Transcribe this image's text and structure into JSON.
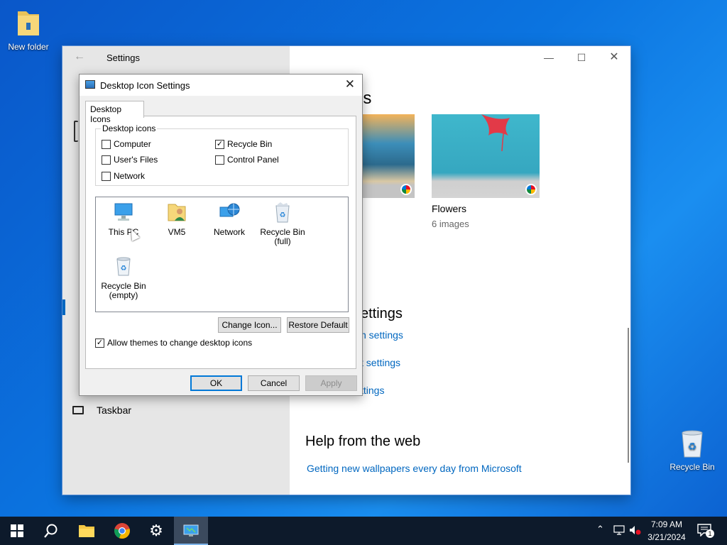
{
  "desktop": {
    "icons": [
      {
        "label": "New folder",
        "icon": "folder-icon"
      },
      {
        "label": "Recycle Bin",
        "icon": "recycle-bin-icon"
      }
    ]
  },
  "settings": {
    "title": "Settings",
    "left_items": [
      {
        "label": "Taskbar",
        "icon": "taskbar-icon"
      }
    ],
    "theme_section_heading_fragment": "es",
    "themes": [
      {
        "name": "",
        "count": ""
      },
      {
        "name": "Flowers",
        "count": "6 images"
      }
    ],
    "related_heading_fragment": "ettings",
    "related_links": [
      "n settings",
      "t settings",
      "ttings"
    ],
    "help_heading": "Help from the web",
    "help_link": "Getting new wallpapers every day from Microsoft"
  },
  "dialog": {
    "title": "Desktop Icon Settings",
    "tab_label": "Desktop Icons",
    "group_label": "Desktop icons",
    "checkboxes": [
      {
        "label": "Computer",
        "checked": false
      },
      {
        "label": "Recycle Bin",
        "checked": true
      },
      {
        "label": "User's Files",
        "checked": false
      },
      {
        "label": "Control Panel",
        "checked": false
      },
      {
        "label": "Network",
        "checked": false
      }
    ],
    "icons": [
      {
        "label": "This PC",
        "icon": "monitor-icon"
      },
      {
        "label": "VM5",
        "icon": "user-folder-icon"
      },
      {
        "label": "Network",
        "icon": "network-globe-icon"
      },
      {
        "label": "Recycle Bin\n(full)",
        "icon": "recycle-bin-full-icon"
      },
      {
        "label": "Recycle Bin\n(empty)",
        "icon": "recycle-bin-empty-icon"
      }
    ],
    "change_icon_label": "Change Icon...",
    "restore_default_label": "Restore Default",
    "allow_themes_label": "Allow themes to change desktop icons",
    "allow_themes_checked": true,
    "ok_label": "OK",
    "cancel_label": "Cancel",
    "apply_label": "Apply"
  },
  "taskbar": {
    "time": "7:09 AM",
    "date": "3/21/2024",
    "notification_count": "1",
    "apps": [
      "start-icon",
      "search-icon",
      "file-explorer-icon",
      "chrome-icon",
      "settings-gear-icon",
      "desktop-icon-settings-icon"
    ]
  },
  "colors": {
    "accent": "#0067c0",
    "desktop_bg": "#0b74e0",
    "taskbar_bg": "#0d1a2b"
  }
}
